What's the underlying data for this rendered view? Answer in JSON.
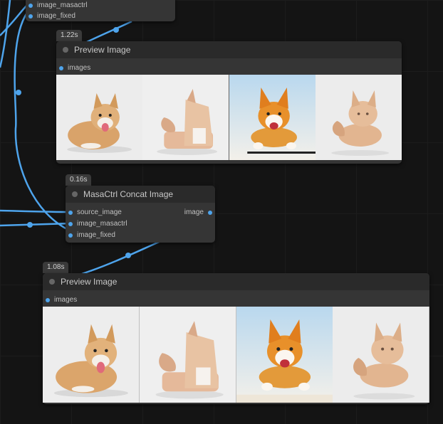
{
  "top_node": {
    "inputs": [
      "image_masactrl",
      "image_fixed"
    ]
  },
  "preview_1": {
    "timing": "1.22s",
    "title": "Preview Image",
    "input": "images"
  },
  "concat_node": {
    "timing": "0.16s",
    "title": "MasaCtrl Concat Image",
    "inputs": [
      "source_image",
      "image_masactrl",
      "image_fixed"
    ],
    "output": "image"
  },
  "preview_2": {
    "timing": "1.08s",
    "title": "Preview Image",
    "input": "images"
  },
  "colors": {
    "canvas": "#141414",
    "node_body": "#353535",
    "node_header": "#2a2a2a",
    "wire": "#4ea4ec"
  },
  "images": [
    "corgi-lying",
    "corgi-shape-object",
    "corgi-running",
    "corgi-shape-running"
  ]
}
